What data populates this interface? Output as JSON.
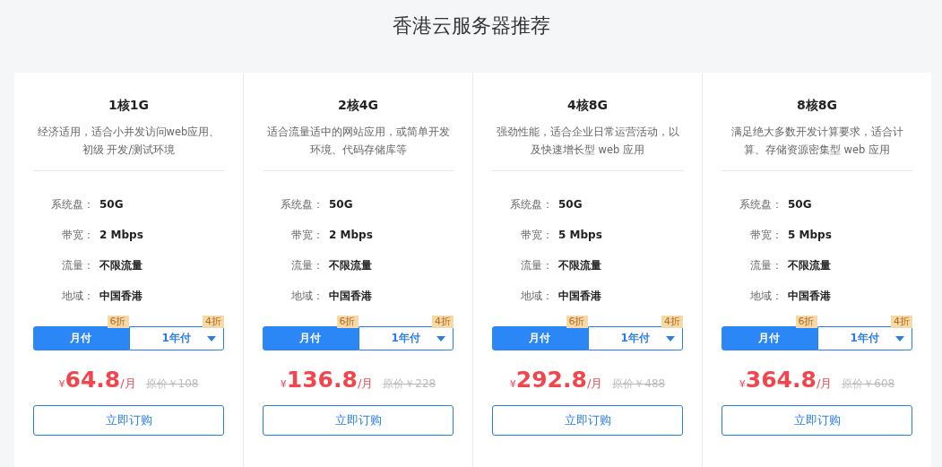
{
  "title": "香港云服务器推荐",
  "plans": [
    {
      "name": "1核1G",
      "description": "经济适用，适合小并发访问web应用、初级 开发/测试环境",
      "specs": [
        {
          "label": "系统盘：",
          "value": "50G"
        },
        {
          "label": "带宽：",
          "value": "2 Mbps"
        },
        {
          "label": "流量：",
          "value": "不限流量"
        },
        {
          "label": "地域：",
          "value": "中国香港"
        }
      ],
      "billing": [
        {
          "label": "月付",
          "badge": "6折",
          "selected": true,
          "kind": "plain"
        },
        {
          "label": "1年付",
          "badge": "4折",
          "selected": false,
          "kind": "dropdown"
        }
      ],
      "currency": "¥",
      "price": "64.8",
      "unit": "/月",
      "original_price": "原价￥108",
      "button": "立即订购"
    },
    {
      "name": "2核4G",
      "description": "适合流量适中的网站应用，或简单开发环境、代码存储库等",
      "specs": [
        {
          "label": "系统盘：",
          "value": "50G"
        },
        {
          "label": "带宽：",
          "value": "2 Mbps"
        },
        {
          "label": "流量：",
          "value": "不限流量"
        },
        {
          "label": "地域：",
          "value": "中国香港"
        }
      ],
      "billing": [
        {
          "label": "月付",
          "badge": "6折",
          "selected": true,
          "kind": "plain"
        },
        {
          "label": "1年付",
          "badge": "4折",
          "selected": false,
          "kind": "dropdown"
        }
      ],
      "currency": "¥",
      "price": "136.8",
      "unit": "/月",
      "original_price": "原价￥228",
      "button": "立即订购"
    },
    {
      "name": "4核8G",
      "description": "强劲性能，适合企业日常运营活动，以及快速增长型 web 应用",
      "specs": [
        {
          "label": "系统盘：",
          "value": "50G"
        },
        {
          "label": "带宽：",
          "value": "5 Mbps"
        },
        {
          "label": "流量：",
          "value": "不限流量"
        },
        {
          "label": "地域：",
          "value": "中国香港"
        }
      ],
      "billing": [
        {
          "label": "月付",
          "badge": "6折",
          "selected": true,
          "kind": "plain"
        },
        {
          "label": "1年付",
          "badge": "4折",
          "selected": false,
          "kind": "dropdown"
        }
      ],
      "currency": "¥",
      "price": "292.8",
      "unit": "/月",
      "original_price": "原价￥488",
      "button": "立即订购"
    },
    {
      "name": "8核8G",
      "description": "满足绝大多数开发计算要求，适合计算、存储资源密集型 web 应用",
      "specs": [
        {
          "label": "系统盘：",
          "value": "50G"
        },
        {
          "label": "带宽：",
          "value": "5 Mbps"
        },
        {
          "label": "流量：",
          "value": "不限流量"
        },
        {
          "label": "地域：",
          "value": "中国香港"
        }
      ],
      "billing": [
        {
          "label": "月付",
          "badge": "6折",
          "selected": true,
          "kind": "plain"
        },
        {
          "label": "1年付",
          "badge": "4折",
          "selected": false,
          "kind": "dropdown"
        }
      ],
      "currency": "¥",
      "price": "364.8",
      "unit": "/月",
      "original_price": "原价￥608",
      "button": "立即订购"
    }
  ]
}
